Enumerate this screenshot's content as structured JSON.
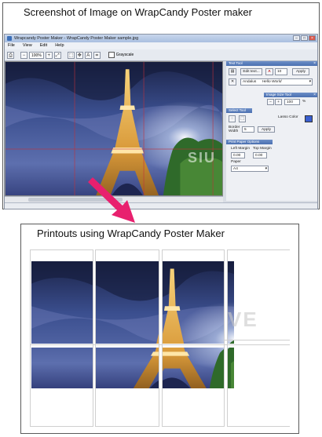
{
  "captions": {
    "top": "Screenshot of Image on WrapCandy Poster maker",
    "bottom": "Printouts using WrapCandy Poster Maker"
  },
  "window": {
    "title": "Wrapcandy Poster Maker - WrapCandy Poster Maker sample.jpg",
    "menu": [
      "File",
      "View",
      "Edit",
      "Help"
    ],
    "zoom": "100%",
    "grayscale_label": "Grayscale"
  },
  "panel": {
    "text_tool": {
      "title": "Text Tool",
      "edit_label": "Edit text...",
      "size_value": "10",
      "apply_label": "Apply",
      "font_value": "Andalus",
      "font_preview": "Hello World"
    },
    "image_size_tool": {
      "title": "Image Size Tool",
      "value": "100",
      "unit": "%"
    },
    "select_tool": {
      "title": "Select Tool",
      "lasso_label": "Lasso Color",
      "border_label": "Border Width",
      "border_value": "5",
      "apply_label": "Apply"
    },
    "print_options": {
      "title": "Print Paper Options",
      "left_margin_label": "Left Margin",
      "left_margin_value": "0.00",
      "top_margin_label": "Top Margin",
      "top_margin_value": "0.00",
      "paper_label": "Paper",
      "paper_value": "A4"
    }
  },
  "colors": {
    "accent_arrow": "#e8206e",
    "panel_header": "#4a6fb0",
    "lasso_color": "#3a5fd0"
  }
}
